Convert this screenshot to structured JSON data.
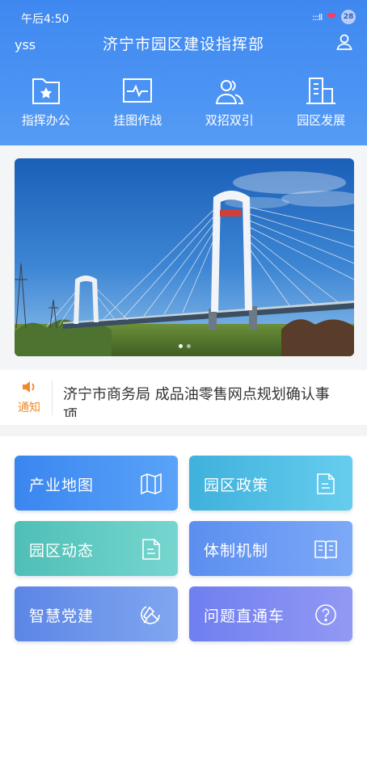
{
  "status_bar": {
    "time": "午后4:50",
    "signal": ":::ll",
    "battery": "28"
  },
  "header": {
    "username": "yss",
    "title": "济宁市园区建设指挥部"
  },
  "quick_nav": [
    {
      "label": "指挥办公",
      "icon": "folder-star-icon"
    },
    {
      "label": "挂图作战",
      "icon": "pulse-chart-icon"
    },
    {
      "label": "双招双引",
      "icon": "people-icon"
    },
    {
      "label": "园区发展",
      "icon": "buildings-icon"
    }
  ],
  "banner": {
    "slides": 2,
    "active_index": 1
  },
  "notice": {
    "label": "通知",
    "text": "济宁市商务局 成品油零售网点规划确认事项"
  },
  "tiles": [
    {
      "label": "产业地图",
      "icon": "map-icon"
    },
    {
      "label": "园区政策",
      "icon": "document-icon"
    },
    {
      "label": "园区动态",
      "icon": "document-icon"
    },
    {
      "label": "体制机制",
      "icon": "book-icon"
    },
    {
      "label": "智慧党建",
      "icon": "party-emblem-icon"
    },
    {
      "label": "问题直通车",
      "icon": "question-icon"
    }
  ],
  "colors": {
    "header": "#4b93f3",
    "notice_accent": "#f08a2a"
  }
}
